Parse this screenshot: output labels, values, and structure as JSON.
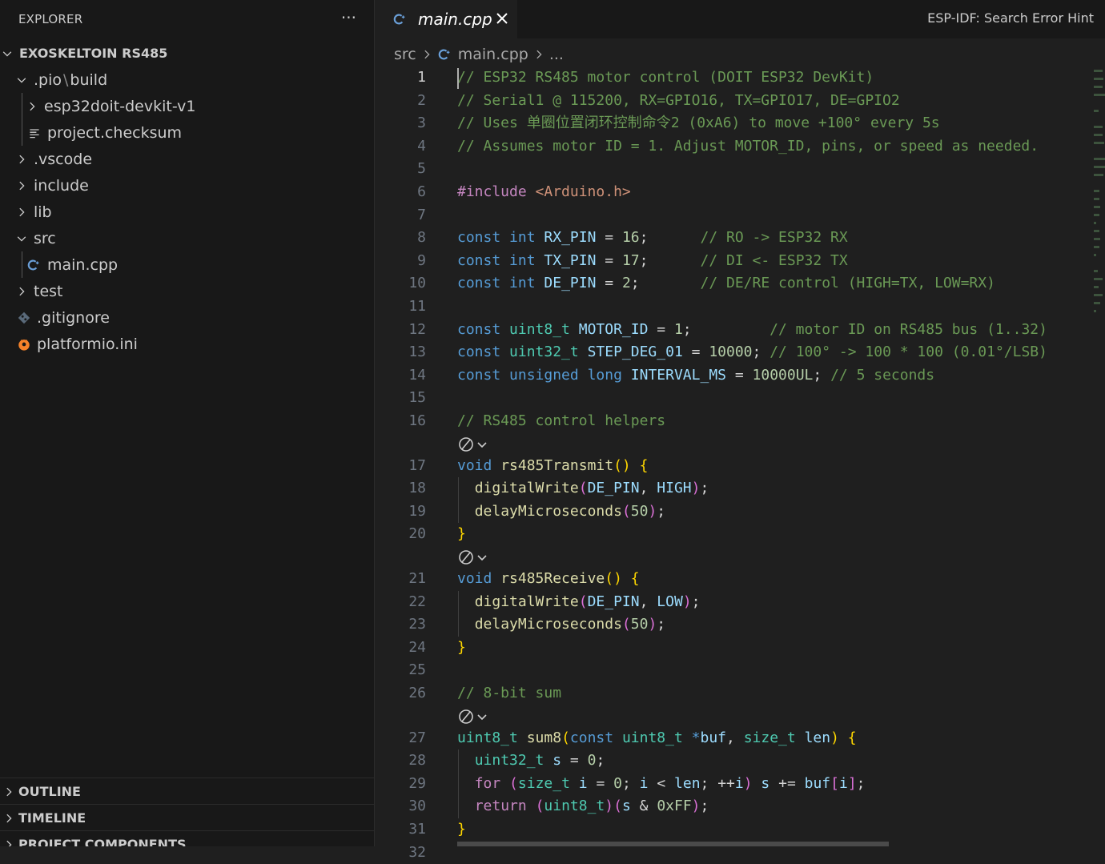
{
  "explorer": {
    "title": "EXPLORER",
    "more_label": "···",
    "root": "EXOSKELTOIN RS485",
    "items": [
      {
        "label": ".pio",
        "label2": "build",
        "sep": "\\",
        "icon": "chevron-down",
        "level": 1
      },
      {
        "label": "esp32doit-devkit-v1",
        "icon": "chevron-right",
        "level": 2
      },
      {
        "label": "project.checksum",
        "icon": "lines-file-icon",
        "level": 2
      },
      {
        "label": ".vscode",
        "icon": "chevron-right",
        "level": 1
      },
      {
        "label": "include",
        "icon": "chevron-right",
        "level": 1
      },
      {
        "label": "lib",
        "icon": "chevron-right",
        "level": 1
      },
      {
        "label": "src",
        "icon": "chevron-down",
        "level": 1
      },
      {
        "label": "main.cpp",
        "icon": "cpp-file-icon",
        "level": 2,
        "selected": true
      },
      {
        "label": "test",
        "icon": "chevron-right",
        "level": 1
      },
      {
        "label": ".gitignore",
        "icon": "git-file-icon",
        "level": 1
      },
      {
        "label": "platformio.ini",
        "icon": "platformio-file-icon",
        "level": 1
      }
    ],
    "sections": [
      "OUTLINE",
      "TIMELINE",
      "PROJECT COMPONENTS"
    ]
  },
  "tabs": [
    {
      "label": "main.cpp",
      "active": true,
      "icon": "cpp-file-icon"
    }
  ],
  "status_hint": "ESP-IDF: Search Error Hint",
  "breadcrumb": {
    "items": [
      "src",
      "main.cpp",
      "..."
    ]
  },
  "editor": {
    "current_line": 1,
    "lines": [
      {
        "n": 1,
        "tokens": [
          [
            "c",
            "// ESP32 RS485 motor control (DOIT ESP32 DevKit)"
          ]
        ]
      },
      {
        "n": 2,
        "tokens": [
          [
            "c",
            "// Serial1 @ 115200, RX=GPIO16, TX=GPIO17, DE=GPIO2"
          ]
        ]
      },
      {
        "n": 3,
        "tokens": [
          [
            "c",
            "// Uses 单圈位置闭环控制命令2 (0xA6) to move +100° every 5s"
          ]
        ]
      },
      {
        "n": 4,
        "tokens": [
          [
            "c",
            "// Assumes motor ID = 1. Adjust MOTOR_ID, pins, or speed as needed."
          ]
        ]
      },
      {
        "n": 5,
        "tokens": []
      },
      {
        "n": 6,
        "tokens": [
          [
            "p",
            "#include"
          ],
          [
            "",
            ""
          ],
          [
            "s",
            " <Arduino.h>"
          ]
        ]
      },
      {
        "n": 7,
        "tokens": []
      },
      {
        "n": 8,
        "tokens": [
          [
            "k",
            "const"
          ],
          [
            "",
            " "
          ],
          [
            "k",
            "int"
          ],
          [
            "",
            " "
          ],
          [
            "v",
            "RX_PIN"
          ],
          [
            "",
            " = "
          ],
          [
            "n",
            "16"
          ],
          [
            "",
            ";      "
          ],
          [
            "c",
            "// RO -> ESP32 RX"
          ]
        ]
      },
      {
        "n": 9,
        "tokens": [
          [
            "k",
            "const"
          ],
          [
            "",
            " "
          ],
          [
            "k",
            "int"
          ],
          [
            "",
            " "
          ],
          [
            "v",
            "TX_PIN"
          ],
          [
            "",
            " = "
          ],
          [
            "n",
            "17"
          ],
          [
            "",
            ";      "
          ],
          [
            "c",
            "// DI <- ESP32 TX"
          ]
        ]
      },
      {
        "n": 10,
        "tokens": [
          [
            "k",
            "const"
          ],
          [
            "",
            " "
          ],
          [
            "k",
            "int"
          ],
          [
            "",
            " "
          ],
          [
            "v",
            "DE_PIN"
          ],
          [
            "",
            " = "
          ],
          [
            "n",
            "2"
          ],
          [
            "",
            ";       "
          ],
          [
            "c",
            "// DE/RE control (HIGH=TX, LOW=RX)"
          ]
        ]
      },
      {
        "n": 11,
        "tokens": []
      },
      {
        "n": 12,
        "tokens": [
          [
            "k",
            "const"
          ],
          [
            "",
            " "
          ],
          [
            "t",
            "uint8_t"
          ],
          [
            "",
            " "
          ],
          [
            "v",
            "MOTOR_ID"
          ],
          [
            "",
            " = "
          ],
          [
            "n",
            "1"
          ],
          [
            "",
            ";         "
          ],
          [
            "c",
            "// motor ID on RS485 bus (1..32)"
          ]
        ]
      },
      {
        "n": 13,
        "tokens": [
          [
            "k",
            "const"
          ],
          [
            "",
            " "
          ],
          [
            "t",
            "uint32_t"
          ],
          [
            "",
            " "
          ],
          [
            "v",
            "STEP_DEG_01"
          ],
          [
            "",
            " = "
          ],
          [
            "n",
            "10000"
          ],
          [
            "",
            "; "
          ],
          [
            "c",
            "// 100° -> 100 * 100 (0.01°/LSB)"
          ]
        ]
      },
      {
        "n": 14,
        "tokens": [
          [
            "k",
            "const"
          ],
          [
            "",
            " "
          ],
          [
            "k",
            "unsigned"
          ],
          [
            "",
            " "
          ],
          [
            "k",
            "long"
          ],
          [
            "",
            " "
          ],
          [
            "v",
            "INTERVAL_MS"
          ],
          [
            "",
            " = "
          ],
          [
            "n",
            "10000UL"
          ],
          [
            "",
            "; "
          ],
          [
            "c",
            "// 5 seconds"
          ]
        ]
      },
      {
        "n": 15,
        "tokens": []
      },
      {
        "n": 16,
        "tokens": [
          [
            "c",
            "// RS485 control helpers"
          ]
        ]
      },
      {
        "n": null,
        "codelens": true
      },
      {
        "n": 17,
        "tokens": [
          [
            "k",
            "void"
          ],
          [
            "",
            " "
          ],
          [
            "f",
            "rs485Transmit"
          ],
          [
            "b1",
            "()"
          ],
          [
            "",
            " "
          ],
          [
            "b1",
            "{"
          ]
        ]
      },
      {
        "n": 18,
        "tokens": [
          [
            "",
            "  "
          ],
          [
            "f",
            "digitalWrite"
          ],
          [
            "b2",
            "("
          ],
          [
            "v",
            "DE_PIN"
          ],
          [
            "",
            ", "
          ],
          [
            "v",
            "HIGH"
          ],
          [
            "b2",
            ")"
          ],
          [
            "",
            ";"
          ]
        ]
      },
      {
        "n": 19,
        "tokens": [
          [
            "",
            "  "
          ],
          [
            "f",
            "delayMicroseconds"
          ],
          [
            "b2",
            "("
          ],
          [
            "n",
            "50"
          ],
          [
            "b2",
            ")"
          ],
          [
            "",
            ";"
          ]
        ]
      },
      {
        "n": 20,
        "tokens": [
          [
            "b1",
            "}"
          ]
        ]
      },
      {
        "n": null,
        "codelens": true
      },
      {
        "n": 21,
        "tokens": [
          [
            "k",
            "void"
          ],
          [
            "",
            " "
          ],
          [
            "f",
            "rs485Receive"
          ],
          [
            "b1",
            "()"
          ],
          [
            "",
            " "
          ],
          [
            "b1",
            "{"
          ]
        ]
      },
      {
        "n": 22,
        "tokens": [
          [
            "",
            "  "
          ],
          [
            "f",
            "digitalWrite"
          ],
          [
            "b2",
            "("
          ],
          [
            "v",
            "DE_PIN"
          ],
          [
            "",
            ", "
          ],
          [
            "v",
            "LOW"
          ],
          [
            "b2",
            ")"
          ],
          [
            "",
            ";"
          ]
        ]
      },
      {
        "n": 23,
        "tokens": [
          [
            "",
            "  "
          ],
          [
            "f",
            "delayMicroseconds"
          ],
          [
            "b2",
            "("
          ],
          [
            "n",
            "50"
          ],
          [
            "b2",
            ")"
          ],
          [
            "",
            ";"
          ]
        ]
      },
      {
        "n": 24,
        "tokens": [
          [
            "b1",
            "}"
          ]
        ]
      },
      {
        "n": 25,
        "tokens": []
      },
      {
        "n": 26,
        "tokens": [
          [
            "c",
            "// 8-bit sum"
          ]
        ]
      },
      {
        "n": null,
        "codelens": true
      },
      {
        "n": 27,
        "tokens": [
          [
            "t",
            "uint8_t"
          ],
          [
            "",
            " "
          ],
          [
            "f",
            "sum8"
          ],
          [
            "b1",
            "("
          ],
          [
            "k",
            "const"
          ],
          [
            "",
            " "
          ],
          [
            "t",
            "uint8_t"
          ],
          [
            "",
            " "
          ],
          [
            "k",
            "*"
          ],
          [
            "v",
            "buf"
          ],
          [
            "",
            ", "
          ],
          [
            "t",
            "size_t"
          ],
          [
            "",
            " "
          ],
          [
            "v",
            "len"
          ],
          [
            "b1",
            ")"
          ],
          [
            "",
            " "
          ],
          [
            "b1",
            "{"
          ]
        ]
      },
      {
        "n": 28,
        "tokens": [
          [
            "",
            "  "
          ],
          [
            "t",
            "uint32_t"
          ],
          [
            "",
            " "
          ],
          [
            "v",
            "s"
          ],
          [
            "",
            " = "
          ],
          [
            "n",
            "0"
          ],
          [
            "",
            ";"
          ]
        ]
      },
      {
        "n": 29,
        "tokens": [
          [
            "",
            "  "
          ],
          [
            "p",
            "for"
          ],
          [
            "",
            " "
          ],
          [
            "b2",
            "("
          ],
          [
            "t",
            "size_t"
          ],
          [
            "",
            " "
          ],
          [
            "v",
            "i"
          ],
          [
            "",
            " = "
          ],
          [
            "n",
            "0"
          ],
          [
            "",
            "; "
          ],
          [
            "v",
            "i"
          ],
          [
            "",
            " < "
          ],
          [
            "v",
            "len"
          ],
          [
            "",
            "; ++"
          ],
          [
            "v",
            "i"
          ],
          [
            "b2",
            ")"
          ],
          [
            "",
            " "
          ],
          [
            "v",
            "s"
          ],
          [
            "",
            " += "
          ],
          [
            "v",
            "buf"
          ],
          [
            "b2",
            "["
          ],
          [
            "v",
            "i"
          ],
          [
            "b2",
            "]"
          ],
          [
            "",
            ";"
          ]
        ]
      },
      {
        "n": 30,
        "tokens": [
          [
            "",
            "  "
          ],
          [
            "p",
            "return"
          ],
          [
            "",
            " "
          ],
          [
            "b2",
            "("
          ],
          [
            "t",
            "uint8_t"
          ],
          [
            "b2",
            ")"
          ],
          [
            "b2",
            "("
          ],
          [
            "v",
            "s"
          ],
          [
            "",
            " & "
          ],
          [
            "n",
            "0xFF"
          ],
          [
            "b2",
            ")"
          ],
          [
            "",
            ";"
          ]
        ]
      },
      {
        "n": 31,
        "tokens": [
          [
            "b1",
            "}"
          ]
        ]
      },
      {
        "n": 32,
        "tokens": []
      }
    ]
  }
}
